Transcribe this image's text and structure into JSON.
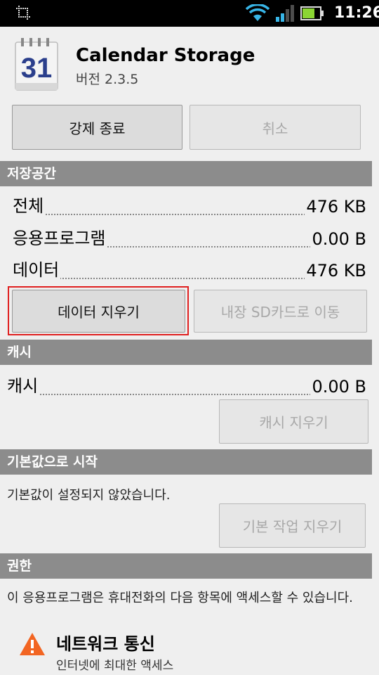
{
  "status_bar": {
    "time": "11:26"
  },
  "app": {
    "name": "Calendar Storage",
    "version": "버전 2.3.5",
    "icon_day": "31"
  },
  "buttons": {
    "force_stop": "강제 종료",
    "cancel": "취소",
    "clear_data": "데이터 지우기",
    "move_sd": "내장 SD카드로 이동",
    "clear_cache": "캐시 지우기",
    "clear_defaults": "기본 작업 지우기"
  },
  "storage": {
    "header": "저장공간",
    "rows": [
      {
        "label": "전체",
        "value": "476 KB"
      },
      {
        "label": "응용프로그램",
        "value": "0.00 B"
      },
      {
        "label": "데이터",
        "value": "476 KB"
      }
    ]
  },
  "cache": {
    "header": "캐시",
    "label": "캐시",
    "value": "0.00 B"
  },
  "defaults": {
    "header": "기본값으로 시작",
    "text": "기본값이 설정되지 않았습니다."
  },
  "permissions": {
    "header": "권한",
    "text": "이 응용프로그램은 휴대전화의 다음 항목에 액세스할 수 있습니다.",
    "item_title": "네트워크 통신",
    "item_desc": "인터넷에 최대한 액세스"
  },
  "colors": {
    "section_bg": "#8c8c8c",
    "highlight": "#e02020",
    "warning": "#f26522",
    "icon_blue": "#2b3f8c"
  }
}
